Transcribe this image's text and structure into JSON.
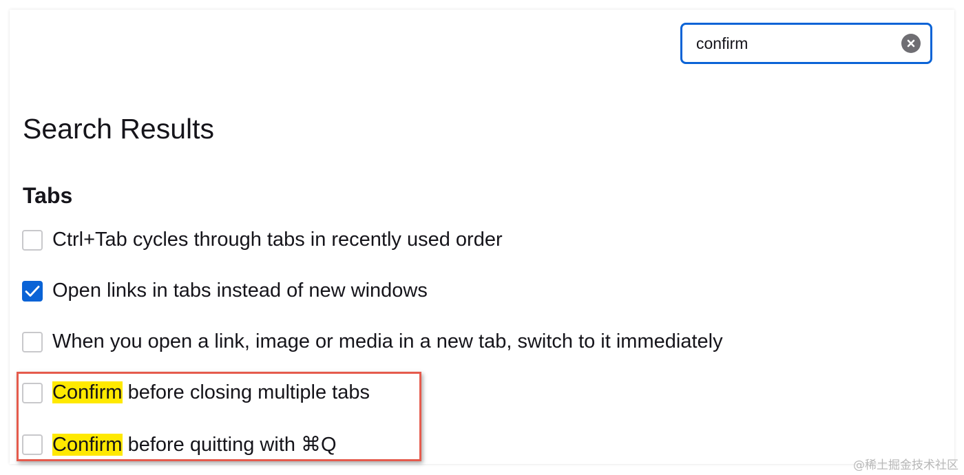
{
  "search": {
    "value": "confirm"
  },
  "results": {
    "heading": "Search Results",
    "section_title": "Tabs",
    "options": [
      {
        "label": "Ctrl+Tab cycles through tabs in recently used order",
        "checked": false
      },
      {
        "label": "Open links in tabs instead of new windows",
        "checked": true
      },
      {
        "label": "When you open a link, image or media in a new tab, switch to it immediately",
        "checked": false
      },
      {
        "highlight": "Confirm",
        "label_rest": " before closing multiple tabs",
        "checked": false
      },
      {
        "highlight": "Confirm",
        "label_rest": " before quitting with ⌘Q",
        "checked": false
      }
    ]
  },
  "watermark": "@稀土掘金技术社区",
  "colors": {
    "accent": "#0a63d6",
    "match_highlight": "#ffe900",
    "annotation_border": "#e55b4d"
  },
  "icons": {
    "clear": "clear-circle-icon",
    "check": "checkmark-icon"
  }
}
